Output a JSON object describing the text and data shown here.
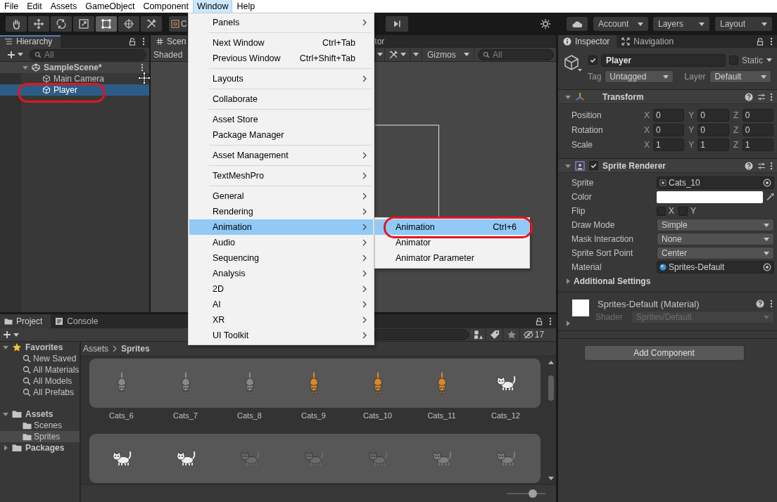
{
  "menu_bar": {
    "items": [
      {
        "label": "File",
        "selected": false
      },
      {
        "label": "Edit",
        "selected": false
      },
      {
        "label": "Assets",
        "selected": false
      },
      {
        "label": "GameObject",
        "selected": false
      },
      {
        "label": "Component",
        "selected": false
      },
      {
        "label": "Window",
        "selected": true
      },
      {
        "label": "Help",
        "selected": false
      }
    ]
  },
  "toolbar": {
    "tools": [
      {
        "kind": "hand",
        "selected": false
      },
      {
        "kind": "move",
        "selected": false
      },
      {
        "kind": "rotate",
        "selected": false
      },
      {
        "kind": "scale",
        "selected": false
      },
      {
        "kind": "rect",
        "selected": true
      },
      {
        "kind": "transform",
        "selected": false
      },
      {
        "kind": "custom",
        "selected": false
      }
    ],
    "pivot": {
      "label": "C"
    },
    "dropdowns": [
      {
        "label": "Account"
      },
      {
        "label": "Layers"
      },
      {
        "label": "Layout"
      }
    ]
  },
  "hierarchy": {
    "tabs": [
      {
        "label": "Hierarchy",
        "kind": "hierarchy",
        "selected": true,
        "focused": true
      }
    ],
    "search": {
      "placeholder": "All"
    },
    "tree": [
      {
        "label": "SampleScene*",
        "kind": "scene",
        "expanded": true,
        "selected": false,
        "circled": false,
        "children": [
          {
            "label": "Main Camera",
            "kind": "object",
            "selected": false,
            "circled": false
          },
          {
            "label": "Player",
            "kind": "object",
            "selected": true,
            "circled": true
          }
        ]
      }
    ]
  },
  "scene_view": {
    "tabs": [
      {
        "label": "Scen",
        "kind": "scene",
        "selected": true
      },
      {
        "label": "tor",
        "selected": false
      }
    ],
    "shading": {
      "label": "Shaded"
    },
    "gizmos": {
      "label": "Gizmos"
    },
    "search": {
      "placeholder": "All"
    }
  },
  "inspector": {
    "tabs": [
      {
        "label": "Inspector",
        "kind": "inspector",
        "selected": true
      },
      {
        "label": "Navigation",
        "kind": "navigation",
        "selected": false
      }
    ],
    "object": {
      "active": true,
      "name": "Player",
      "static": {
        "label": "Static",
        "checked": false
      },
      "tag": {
        "label": "Tag",
        "value": "Untagged"
      },
      "layer": {
        "label": "Layer",
        "value": "Default"
      }
    },
    "components": [
      {
        "title": "Transform",
        "kind": "transform",
        "expanded": true,
        "properties": [
          {
            "label": "Position",
            "kind": "vector3",
            "values": [
              {
                "axis": "X",
                "value": "0"
              },
              {
                "axis": "Y",
                "value": "0"
              },
              {
                "axis": "Z",
                "value": "0"
              }
            ]
          },
          {
            "label": "Rotation",
            "kind": "vector3",
            "values": [
              {
                "axis": "X",
                "value": "0"
              },
              {
                "axis": "Y",
                "value": "0"
              },
              {
                "axis": "Z",
                "value": "0"
              }
            ]
          },
          {
            "label": "Scale",
            "kind": "vector3",
            "values": [
              {
                "axis": "X",
                "value": "1"
              },
              {
                "axis": "Y",
                "value": "1"
              },
              {
                "axis": "Z",
                "value": "1"
              }
            ]
          }
        ]
      },
      {
        "title": "Sprite Renderer",
        "kind": "sprite_renderer",
        "enabled": true,
        "expanded": true,
        "properties": [
          {
            "label": "Sprite",
            "kind": "object",
            "value": "Cats_10"
          },
          {
            "label": "Color",
            "kind": "color",
            "color": "#ffffff"
          },
          {
            "label": "Flip",
            "kind": "flip",
            "toggles": [
              {
                "label": "X",
                "checked": false
              },
              {
                "label": "Y",
                "checked": false
              }
            ]
          },
          {
            "label": "Draw Mode",
            "kind": "dropdown",
            "value": "Simple"
          },
          {
            "label": "Mask Interaction",
            "kind": "dropdown",
            "value": "None"
          },
          {
            "label": "Sprite Sort Point",
            "kind": "dropdown",
            "value": "Center"
          },
          {
            "label": "Material",
            "kind": "material",
            "value": "Sprites-Default"
          }
        ],
        "foldouts": [
          {
            "label": "Additional Settings",
            "expanded": false
          }
        ]
      }
    ],
    "material": {
      "title": "Sprites-Default (Material)",
      "expanded": false,
      "shader": {
        "label": "Shader",
        "value": "Sprites/Default",
        "disabled": true
      }
    },
    "add_component": {
      "label": "Add Component"
    }
  },
  "project": {
    "tabs": [
      {
        "label": "Project",
        "kind": "project",
        "selected": true
      },
      {
        "label": "Console",
        "kind": "console",
        "selected": false
      }
    ],
    "hidden_count": "17",
    "tree": [
      {
        "label": "Favorites",
        "kind": "favorites",
        "expanded": true,
        "selected": false,
        "children": [
          {
            "label": "New Saved",
            "kind": "search",
            "selected": false
          },
          {
            "label": "All Materials",
            "kind": "search",
            "selected": false
          },
          {
            "label": "All Models",
            "kind": "search",
            "selected": false
          },
          {
            "label": "All Prefabs",
            "kind": "search",
            "selected": false
          }
        ]
      },
      {
        "label": "Assets",
        "kind": "folder",
        "expanded": true,
        "selected": false,
        "children": [
          {
            "label": "Scenes",
            "kind": "folder",
            "selected": false
          },
          {
            "label": "Sprites",
            "kind": "folder",
            "selected": true
          }
        ]
      },
      {
        "label": "Packages",
        "kind": "folder",
        "expanded": false,
        "selected": false
      }
    ],
    "breadcrumb": [
      {
        "label": "Assets"
      },
      {
        "label": "Sprites"
      }
    ],
    "sprite_rows": [
      {
        "items": [
          {
            "label": "Cats_6",
            "kind": "front",
            "color": "#8c8781"
          },
          {
            "label": "Cats_7",
            "kind": "front",
            "color": "#8c8781"
          },
          {
            "label": "Cats_8",
            "kind": "front",
            "color": "#8c8781"
          },
          {
            "label": "Cats_9",
            "kind": "front",
            "color": "#d4892c"
          },
          {
            "label": "Cats_10",
            "kind": "front",
            "color": "#d4892c"
          },
          {
            "label": "Cats_11",
            "kind": "front",
            "color": "#d4892c"
          },
          {
            "label": "Cats_12",
            "kind": "side",
            "color": "#eeeeee"
          }
        ]
      },
      {
        "items": [
          {
            "kind": "side",
            "color": "#eeeeee"
          },
          {
            "kind": "side",
            "color": "#eeeeee"
          },
          {
            "kind": "side",
            "color": "#6a6a6a"
          },
          {
            "kind": "side",
            "color": "#6a6a6a"
          },
          {
            "kind": "side",
            "color": "#6a6a6a"
          },
          {
            "kind": "side",
            "color": "#7d7d7d"
          },
          {
            "kind": "side",
            "color": "#7d7d7d"
          }
        ]
      }
    ],
    "icon_size": {
      "level": 0.73
    }
  },
  "window_menu": {
    "groups": [
      {
        "items": [
          {
            "label": "Panels",
            "submenu": true,
            "selected": false
          }
        ]
      },
      {
        "items": [
          {
            "label": "Next Window",
            "shortcut": "Ctrl+Tab",
            "submenu": false,
            "selected": false
          },
          {
            "label": "Previous Window",
            "shortcut": "Ctrl+Shift+Tab",
            "submenu": false,
            "selected": false
          }
        ]
      },
      {
        "items": [
          {
            "label": "Layouts",
            "submenu": true,
            "selected": false
          }
        ]
      },
      {
        "items": [
          {
            "label": "Collaborate",
            "submenu": false,
            "selected": false
          }
        ]
      },
      {
        "items": [
          {
            "label": "Asset Store",
            "submenu": false,
            "selected": false
          },
          {
            "label": "Package Manager",
            "submenu": false,
            "selected": false
          }
        ]
      },
      {
        "items": [
          {
            "label": "Asset Management",
            "submenu": true,
            "selected": false
          }
        ]
      },
      {
        "items": [
          {
            "label": "TextMeshPro",
            "submenu": true,
            "selected": false
          }
        ]
      },
      {
        "items": [
          {
            "label": "General",
            "submenu": true,
            "selected": false
          },
          {
            "label": "Rendering",
            "submenu": true,
            "selected": false
          },
          {
            "label": "Animation",
            "submenu": true,
            "selected": true
          },
          {
            "label": "Audio",
            "submenu": true,
            "selected": false
          },
          {
            "label": "Sequencing",
            "submenu": true,
            "selected": false
          },
          {
            "label": "Analysis",
            "submenu": true,
            "selected": false
          },
          {
            "label": "2D",
            "submenu": true,
            "selected": false
          },
          {
            "label": "AI",
            "submenu": true,
            "selected": false
          },
          {
            "label": "XR",
            "submenu": true,
            "selected": false
          },
          {
            "label": "UI Toolkit",
            "submenu": true,
            "selected": false
          }
        ]
      }
    ],
    "submenu": {
      "items": [
        {
          "label": "Animation",
          "shortcut": "Ctrl+6",
          "selected": true,
          "circled": true
        },
        {
          "label": "Animator",
          "selected": false,
          "circled": false
        },
        {
          "label": "Animator Parameter",
          "selected": false,
          "circled": false
        }
      ]
    }
  }
}
